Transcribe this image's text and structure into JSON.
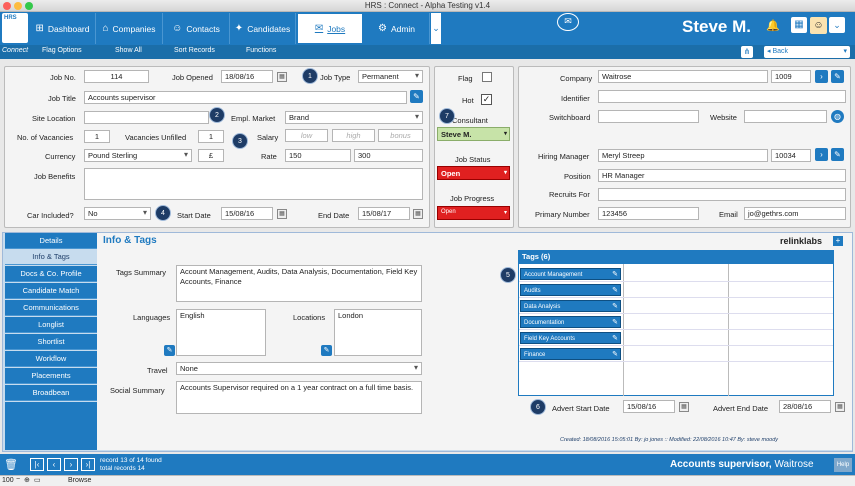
{
  "window": {
    "title": "HRS : Connect - Alpha Testing v1.4"
  },
  "logo": "HRS",
  "nav": {
    "items": [
      {
        "label": "Dashboard",
        "icon": "⊞"
      },
      {
        "label": "Companies",
        "icon": "⌂"
      },
      {
        "label": "Contacts",
        "icon": "☺"
      },
      {
        "label": "Candidates",
        "icon": "✦"
      },
      {
        "label": "Jobs",
        "icon": "✉"
      },
      {
        "label": "Admin",
        "icon": "⚙"
      }
    ],
    "user_name": "Steve M."
  },
  "subnav": {
    "brand": "Connect",
    "items": [
      "Flag Options",
      "Show All",
      "Sort Records",
      "Functions"
    ],
    "back_label": "◂ Back"
  },
  "job": {
    "job_no_label": "Job No.",
    "job_no": "114",
    "job_opened_label": "Job Opened",
    "job_opened": "18/08/16",
    "job_type_label": "Job Type",
    "job_type": "Permanent",
    "job_title_label": "Job Title",
    "job_title": "Accounts supervisor",
    "site_location_label": "Site Location",
    "site_location": "",
    "empl_market_label": "Empl. Market",
    "empl_market": "Brand",
    "vacancies_label": "No. of Vacancies",
    "vacancies": "1",
    "unfilled_label": "Vacancies Unfilled",
    "unfilled": "1",
    "salary_label": "Salary",
    "salary_low": "low",
    "salary_high": "high",
    "salary_bonus": "bonus",
    "currency_label": "Currency",
    "currency": "Pound Sterling",
    "currency_symbol": "£",
    "rate_label": "Rate",
    "rate_1": "150",
    "rate_2": "300",
    "benefits_label": "Job Benefits",
    "car_label": "Car Included?",
    "car": "No",
    "start_date_label": "Start Date",
    "start_date": "15/08/16",
    "end_date_label": "End Date",
    "end_date": "15/08/17"
  },
  "status": {
    "flag_label": "Flag",
    "hot_label": "Hot",
    "consultant_label": "Consultant",
    "consultant": "Steve M.",
    "job_status_label": "Job Status",
    "job_status": "Open",
    "job_progress_label": "Job Progress",
    "job_progress": "Open"
  },
  "company": {
    "company_label": "Company",
    "company": "Waitrose",
    "company_id": "1009",
    "identifier_label": "Identifier",
    "switchboard_label": "Switchboard",
    "website_label": "Website",
    "hiring_manager_label": "Hiring Manager",
    "hiring_manager": "Meryl Streep",
    "hiring_manager_id": "10034",
    "position_label": "Position",
    "position": "HR Manager",
    "recruits_for_label": "Recruits For",
    "primary_number_label": "Primary Number",
    "primary_number": "123456",
    "email_label": "Email",
    "email": "jo@gethrs.com"
  },
  "tabs": [
    "Details",
    "Info & Tags",
    "Docs & Co. Profile",
    "Candidate Match",
    "Communications",
    "Longlist",
    "Shortlist",
    "Workflow",
    "Placements",
    "Broadbean"
  ],
  "info": {
    "heading": "Info & Tags",
    "brand": "relinklabs",
    "tags_summary_label": "Tags Summary",
    "tags_summary": "Account Management, Audits, Data Analysis, Documentation, Field Key Accounts, Finance",
    "languages_label": "Languages",
    "language": "English",
    "locations_label": "Locations",
    "location": "London",
    "travel_label": "Travel",
    "travel": "None",
    "social_summary_label": "Social Summary",
    "social_summary": "Accounts Supervisor required on a 1 year contract on a full time basis.",
    "tags_header": "Tags (6)",
    "tags": [
      "Account Management",
      "Audits",
      "Data Analysis",
      "Documentation",
      "Field Key Accounts",
      "Finance"
    ],
    "advert_start_label": "Advert Start Date",
    "advert_start": "15/08/16",
    "advert_end_label": "Advert End Date",
    "advert_end": "28/08/16",
    "created": "Created: 18/08/2016 15:05:01 By: jo jones :: Modified: 22/08/2016 10:47 By: steve moody"
  },
  "statusbar": {
    "record": "record 13 of 14 found",
    "total": "total records 14",
    "job_caption": "Accounts supervisor",
    "company_caption": "Waitrose",
    "help": "Help"
  },
  "bottom": {
    "zoom": "100",
    "mode": "Browse"
  },
  "badges": [
    "1",
    "2",
    "3",
    "4",
    "5",
    "6",
    "7"
  ]
}
